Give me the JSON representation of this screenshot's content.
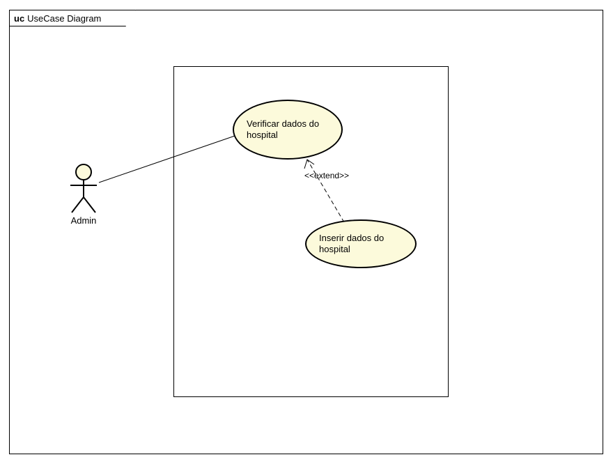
{
  "title": {
    "prefix": "uc",
    "name": "UseCase Diagram"
  },
  "actor": {
    "name": "Admin"
  },
  "usecases": {
    "verify": "Verificar dados do hospital",
    "insert": "Inserir dados do hospital"
  },
  "relationship": {
    "extend_label": "<<extend>>"
  }
}
